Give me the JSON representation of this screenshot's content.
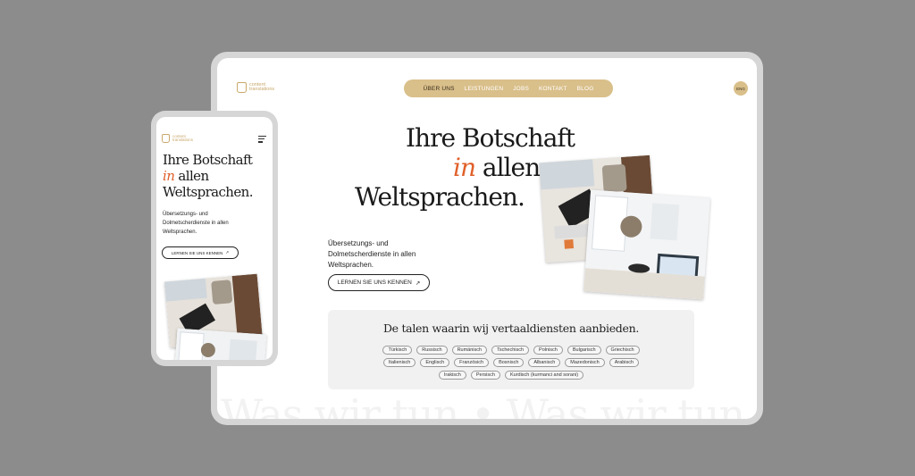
{
  "brand": {
    "logo_text": "content\ntranslations"
  },
  "nav": {
    "items": [
      "ÜBER UNS",
      "LEISTUNGEN",
      "JOBS",
      "KONTAKT",
      "BLOG"
    ],
    "active": "ÜBER UNS"
  },
  "lang": {
    "label": "ENG"
  },
  "hero": {
    "line1": "Ihre Botschaft",
    "line2_accent": "in",
    "line2_rest": " allen",
    "line3": "Weltsprachen.",
    "subtitle": "Übersetzungs- und Dolmetscherdienste in allen Weltsprachen.",
    "cta_label": "LERNEN SIE UNS KENNEN",
    "cta_icon": "arrow-up-right-icon"
  },
  "languages": {
    "title": "De talen waarin wij vertaaldiensten aanbieden.",
    "rows": [
      [
        "Türkisch",
        "Russisch",
        "Rumänisch",
        "Tschechisch",
        "Polnisch",
        "Bulgarisch",
        "Griechisch"
      ],
      [
        "Italienisch",
        "Englisch",
        "Französich",
        "Bosnisch",
        "Albanisch",
        "Mazedonisch",
        "Arabisch"
      ],
      [
        "Irakisch",
        "Persisch",
        "Kurdisch (kurmanci and sorani)"
      ]
    ]
  },
  "watermark": {
    "text": "Was wir tun  •  Was wir tun"
  },
  "colors": {
    "background": "#8c8c8c",
    "accent_gold": "#d9bf8a",
    "accent_orange": "#e0602a",
    "logo": "#c9a86a"
  }
}
